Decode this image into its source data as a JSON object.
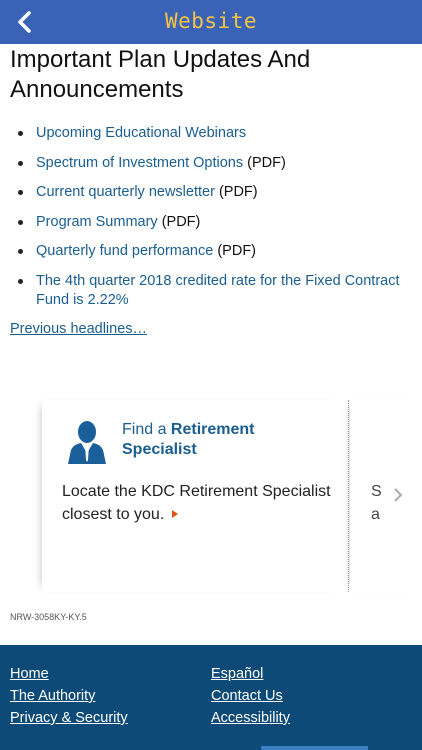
{
  "header": {
    "title": "Website"
  },
  "page": {
    "heading": "Important Plan Updates And Announcements"
  },
  "updates": [
    {
      "link": "Upcoming Educational Webinars",
      "suffix": ""
    },
    {
      "link": "Spectrum of Investment Options",
      "suffix": " (PDF)"
    },
    {
      "link": "Current quarterly newsletter",
      "suffix": " (PDF)"
    },
    {
      "link": "Program Summary",
      "suffix": " (PDF)"
    },
    {
      "link": "Quarterly fund performance",
      "suffix": " (PDF)"
    },
    {
      "link": "The 4th quarter 2018 credited rate for the Fixed Contract Fund is 2.22%",
      "suffix": ""
    }
  ],
  "previous_headlines": "Previous headlines…",
  "carousel": {
    "card1": {
      "title_prefix": "Find a ",
      "title_bold": "Retirement Specialist",
      "body": "Locate the KDC Retirement Specialist closest to you.",
      "icon": "person-icon"
    },
    "card2": {
      "partial_line1": "S",
      "partial_line2": "a"
    }
  },
  "doc_code": "NRW-3058KY-KY.5",
  "footer": {
    "links_left": [
      "Home",
      "The Authority",
      "Privacy & Security"
    ],
    "links_right": [
      "Español",
      "Contact Us",
      "Accessibility"
    ]
  },
  "colors": {
    "topbar": "#3a63b8",
    "title": "#f5c542",
    "link": "#1a5e8f",
    "footer": "#0e4a77",
    "accent_arrow": "#e0521c"
  }
}
